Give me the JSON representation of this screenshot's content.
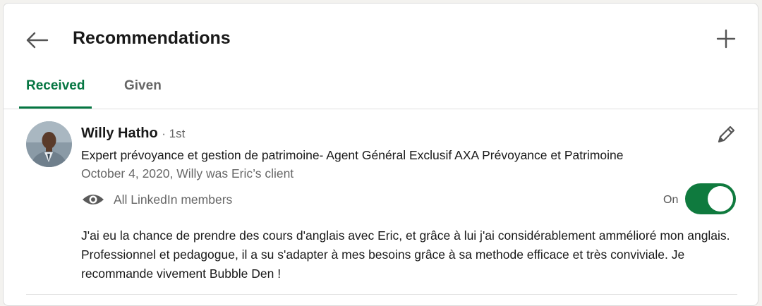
{
  "header": {
    "title": "Recommendations",
    "back_icon": "arrow-left-icon",
    "add_icon": "plus-icon"
  },
  "tabs": [
    {
      "label": "Received",
      "active": true
    },
    {
      "label": "Given",
      "active": false
    }
  ],
  "recommendation": {
    "name": "Willy Hatho",
    "degree": "· 1st",
    "headline": "Expert prévoyance et gestion de patrimoine- Agent Général Exclusif AXA Prévoyance et Patrimoine",
    "meta": "October 4, 2020, Willy was Eric’s client",
    "visibility_label": "All LinkedIn members",
    "visibility_icon": "eye-icon",
    "toggle_label": "On",
    "toggle_on": true,
    "edit_icon": "pencil-icon",
    "text": "J'ai eu la chance de prendre des cours d'anglais avec Eric, et grâce à lui j'ai considérablement ammélioré mon anglais. Professionnel et pedagogue, il a su s'adapter à mes besoins grâce à sa methode efficace et très conviviale. Je recommande vivement Bubble Den !"
  },
  "colors": {
    "accent": "#057642",
    "toggle": "#0f7a3e",
    "muted_text": "#666666"
  }
}
